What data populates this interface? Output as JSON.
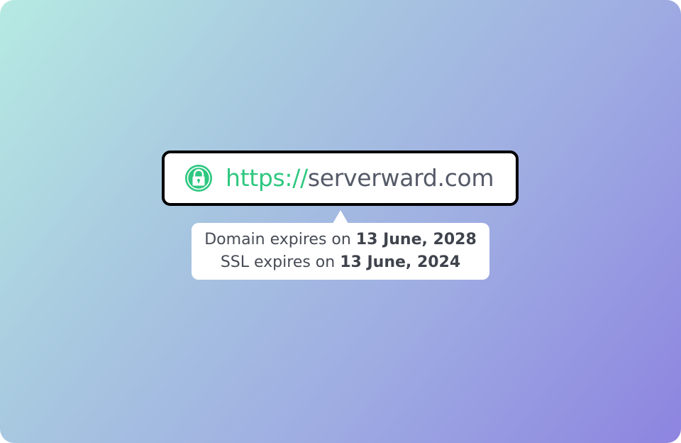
{
  "address_bar": {
    "scheme": "https://",
    "host": "serverward.com",
    "lock_icon": "padlock-icon",
    "accent_color": "#2ec880"
  },
  "tooltip": {
    "domain_prefix": "Domain expires on",
    "domain_date": "13 June, 2028",
    "ssl_prefix": "SSL expires on",
    "ssl_date": "13 June, 2024"
  }
}
